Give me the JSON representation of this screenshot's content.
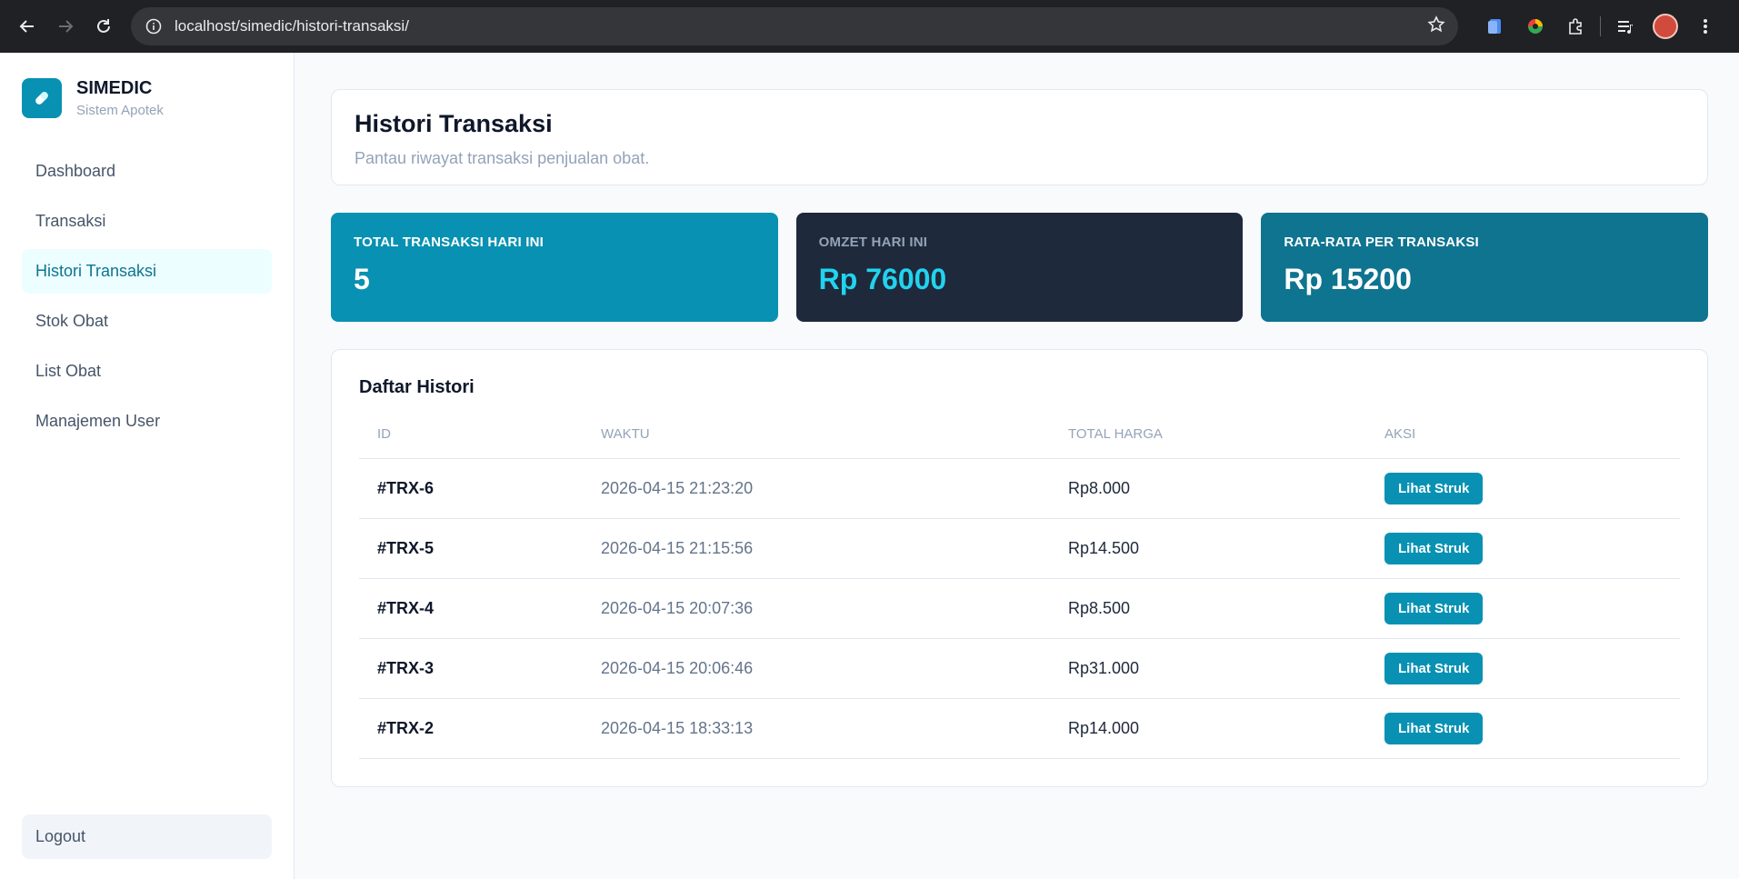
{
  "browser": {
    "url": "localhost/simedic/histori-transaksi/"
  },
  "sidebar": {
    "brand_name": "SIMEDIC",
    "brand_sub": "Sistem Apotek",
    "items": [
      {
        "label": "Dashboard"
      },
      {
        "label": "Transaksi"
      },
      {
        "label": "Histori Transaksi"
      },
      {
        "label": "Stok Obat"
      },
      {
        "label": "List Obat"
      },
      {
        "label": "Manajemen User"
      }
    ],
    "logout_label": "Logout"
  },
  "header": {
    "title": "Histori Transaksi",
    "subtitle": "Pantau riwayat transaksi penjualan obat."
  },
  "stats": [
    {
      "label": "TOTAL TRANSAKSI HARI INI",
      "value": "5"
    },
    {
      "label": "OMZET HARI INI",
      "value": "Rp 76000"
    },
    {
      "label": "RATA-RATA PER TRANSAKSI",
      "value": "Rp 15200"
    }
  ],
  "history": {
    "title": "Daftar Histori",
    "columns": [
      "ID",
      "WAKTU",
      "TOTAL HARGA",
      "AKSI"
    ],
    "rows": [
      {
        "id": "#TRX-6",
        "time": "2026-04-15 21:23:20",
        "total": "Rp8.000",
        "action": "Lihat Struk"
      },
      {
        "id": "#TRX-5",
        "time": "2026-04-15 21:15:56",
        "total": "Rp14.500",
        "action": "Lihat Struk"
      },
      {
        "id": "#TRX-4",
        "time": "2026-04-15 20:07:36",
        "total": "Rp8.500",
        "action": "Lihat Struk"
      },
      {
        "id": "#TRX-3",
        "time": "2026-04-15 20:06:46",
        "total": "Rp31.000",
        "action": "Lihat Struk"
      },
      {
        "id": "#TRX-2",
        "time": "2026-04-15 18:33:13",
        "total": "Rp14.000",
        "action": "Lihat Struk"
      }
    ]
  },
  "colors": {
    "primary": "#0891b2",
    "dark": "#1e293b",
    "teal_dark": "#0e7490",
    "accent_text": "#22d3ee"
  }
}
